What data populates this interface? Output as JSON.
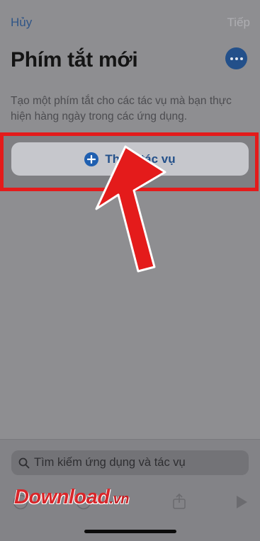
{
  "nav": {
    "cancel_label": "Hủy",
    "next_label": "Tiếp"
  },
  "header": {
    "title": "Phím tắt mới"
  },
  "description": "Tạo một phím tắt cho các tác vụ mà bạn thực hiện hàng ngày trong các ứng dụng.",
  "add_action": {
    "label": "Thêm tác vụ",
    "icon": "plus-circle-icon"
  },
  "search": {
    "placeholder": "Tìm kiếm ứng dụng và tác vụ"
  },
  "toolbar": {
    "icons": [
      "undo-icon",
      "info-icon",
      "share-icon",
      "play-icon"
    ]
  },
  "watermark": {
    "text": "Download",
    "suffix": ".vn"
  },
  "colors": {
    "highlight": "#e41b1b",
    "accent": "#23508a"
  }
}
